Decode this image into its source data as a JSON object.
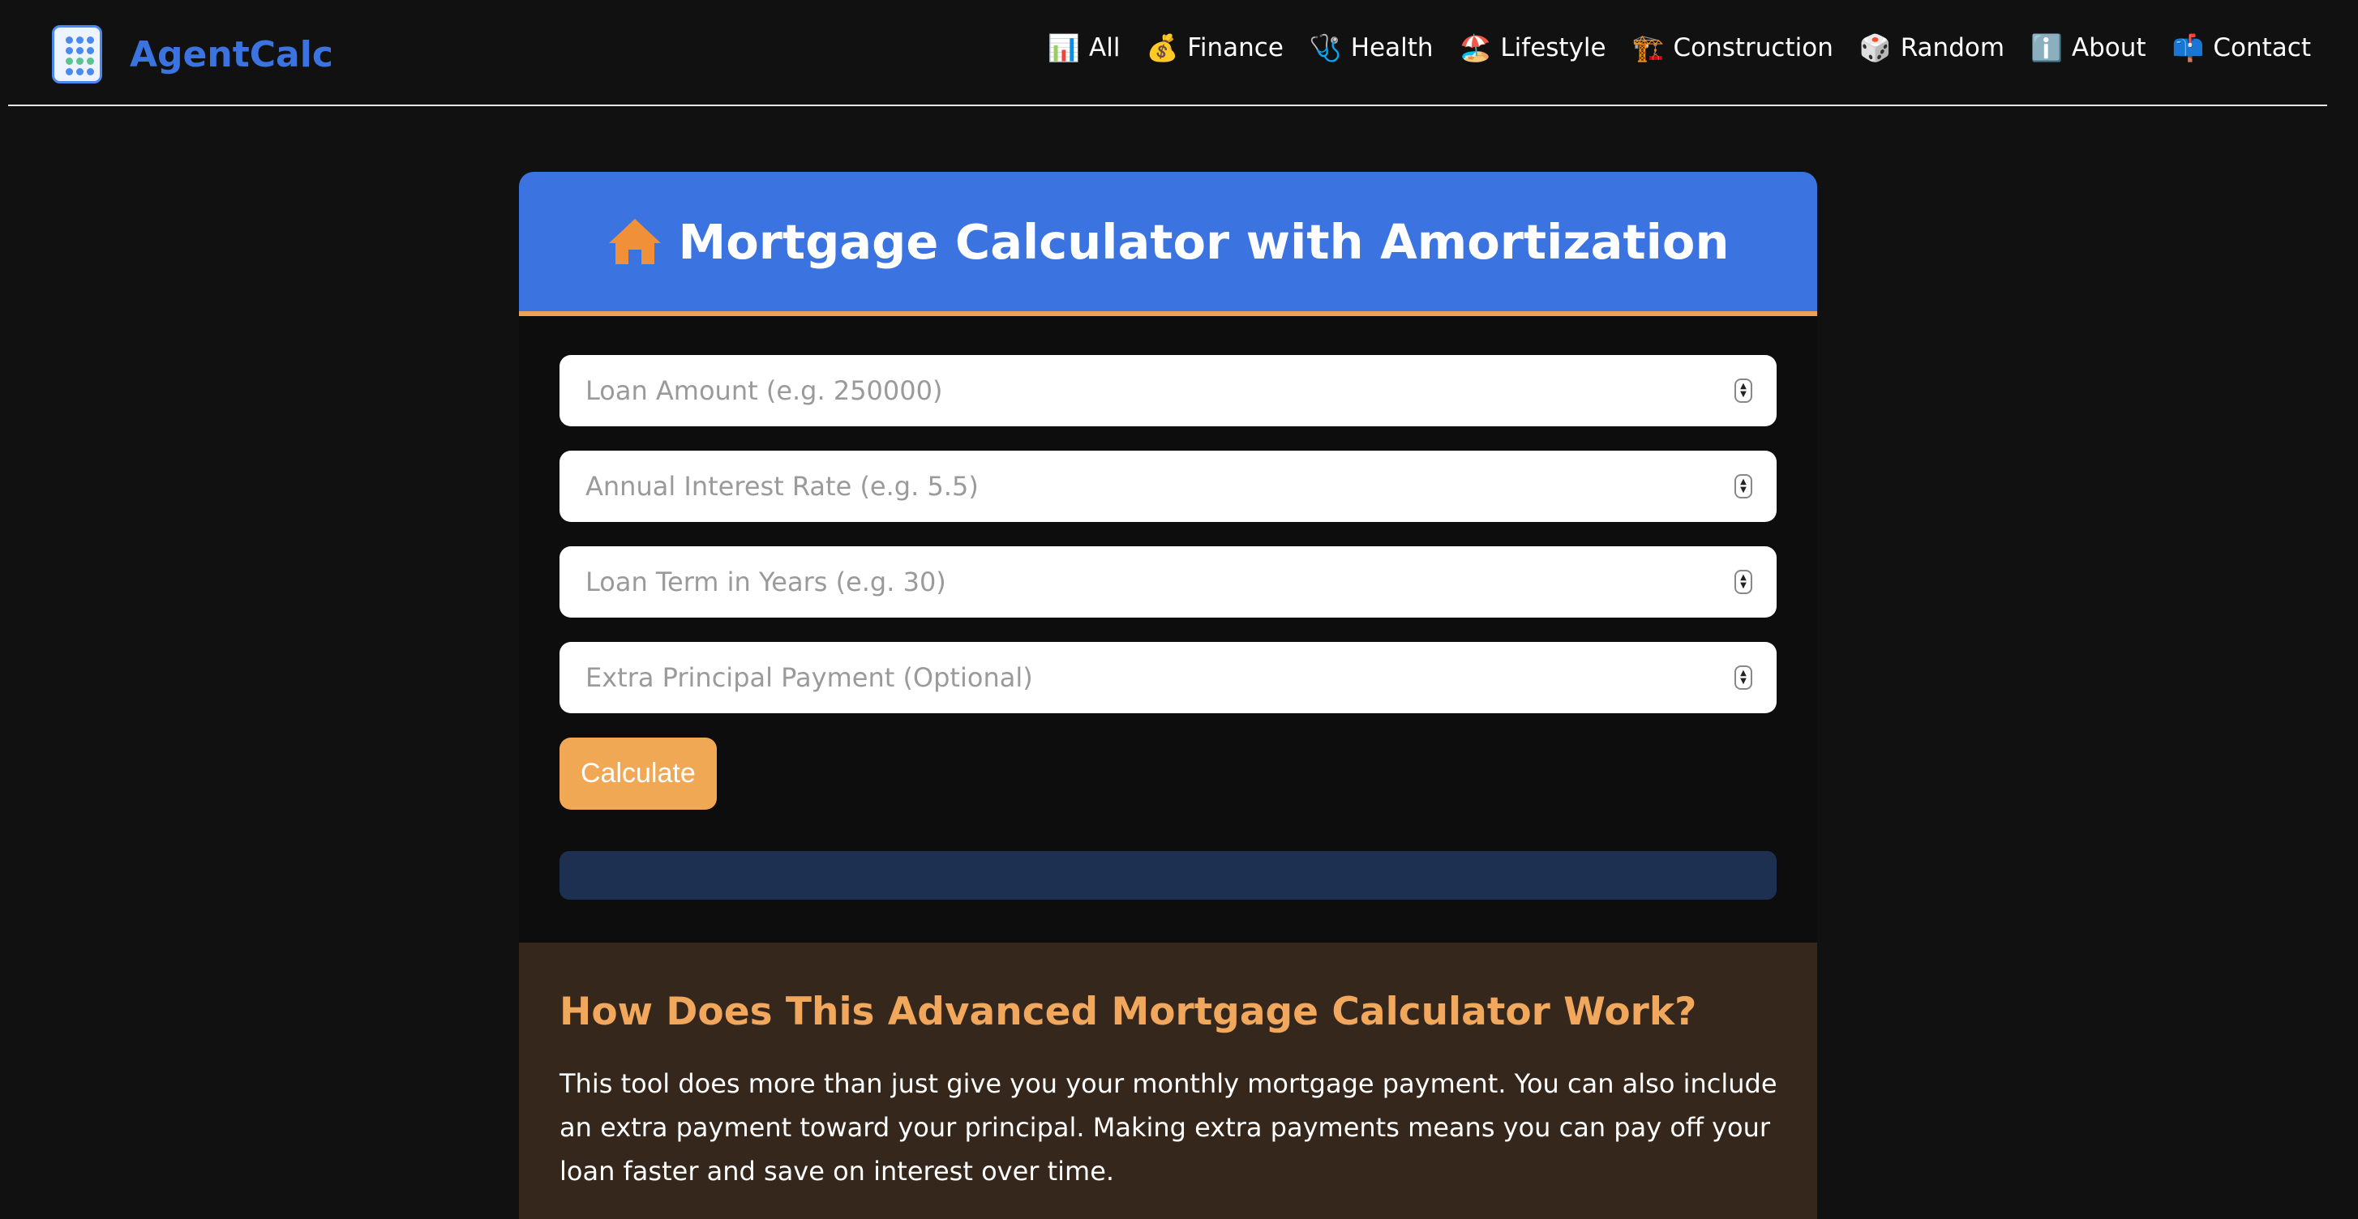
{
  "brand": {
    "name": "AgentCalc"
  },
  "nav": {
    "items": [
      {
        "icon": "📊",
        "label": "All"
      },
      {
        "icon": "💰",
        "label": "Finance"
      },
      {
        "icon": "🩺",
        "label": "Health"
      },
      {
        "icon": "🏖️",
        "label": "Lifestyle"
      },
      {
        "icon": "🏗️",
        "label": "Construction"
      },
      {
        "icon": "🎲",
        "label": "Random"
      },
      {
        "icon": "ℹ️",
        "label": "About"
      },
      {
        "icon": "📫",
        "label": "Contact"
      }
    ]
  },
  "calculator": {
    "title": "Mortgage Calculator with Amortization",
    "title_icon": "house-icon",
    "fields": {
      "loan_amount": {
        "value": "",
        "placeholder": "Loan Amount (e.g. 250000)"
      },
      "interest_rate": {
        "value": "",
        "placeholder": "Annual Interest Rate (e.g. 5.5)"
      },
      "loan_term": {
        "value": "",
        "placeholder": "Loan Term in Years (e.g. 30)"
      },
      "extra_payment": {
        "value": "",
        "placeholder": "Extra Principal Payment (Optional)"
      }
    },
    "calculate_label": "Calculate",
    "result": ""
  },
  "info": {
    "title": "How Does This Advanced Mortgage Calculator Work?",
    "text": "This tool does more than just give you your monthly mortgage payment. You can also include an extra payment toward your principal. Making extra payments means you can pay off your loan faster and save on interest over time."
  },
  "colors": {
    "background": "#111111",
    "brand_blue": "#3b74e0",
    "accent_orange": "#f0a855",
    "result_bg": "#1e3052",
    "info_bg": "#35271c"
  }
}
